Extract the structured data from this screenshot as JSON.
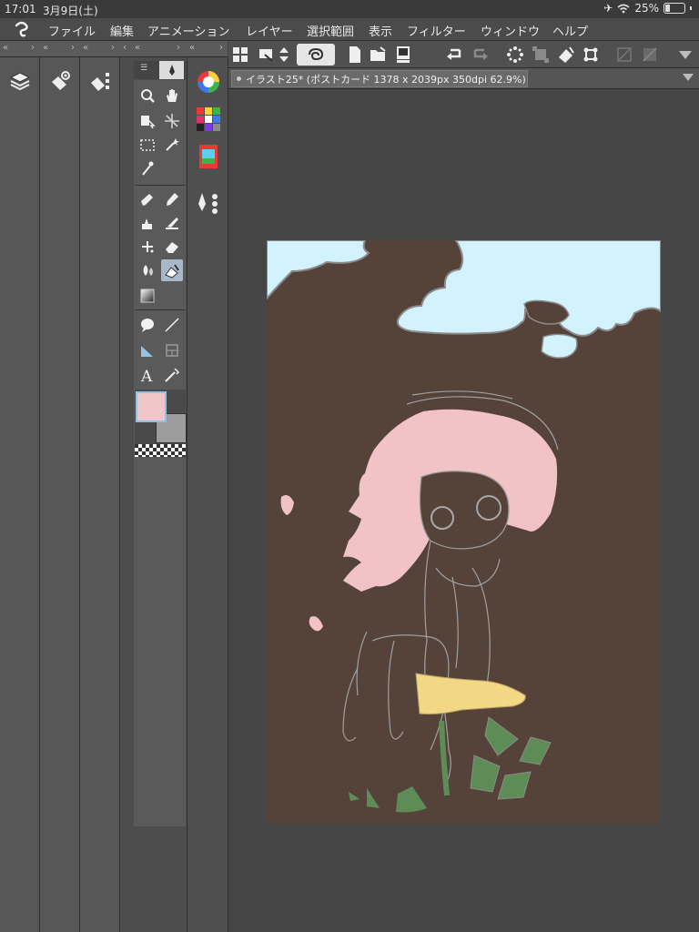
{
  "status_bar": {
    "time": "17:01",
    "date": "3月9日(土)",
    "battery": "25%"
  },
  "menu": {
    "items": [
      "ファイル",
      "編集",
      "アニメーション",
      "レイヤー",
      "選択範囲",
      "表示",
      "フィルター",
      "ウィンドウ",
      "ヘルプ"
    ]
  },
  "document_tab": {
    "title": "イラスト25* (ポストカード 1378 x 2039px 350dpi 62.9%)"
  },
  "colors": {
    "main_color": "#f0c6c9",
    "sub_color": "#9c9c9c",
    "canvas_background": "#55433a",
    "sky": "#d2f3fd",
    "hair": "#f2c3c6",
    "leaf": "#5e8c56",
    "highlight_tool": "#a7b8c9"
  },
  "icons": {
    "left_columns": [
      "layers-icon",
      "layer-property-icon",
      "layer-search-icon"
    ],
    "tools": [
      "zoom-icon",
      "hand-icon",
      "operation-icon",
      "move-layer-icon",
      "selection-icon",
      "auto-select-icon",
      "eyedropper-icon",
      "pen-icon",
      "pencil-icon",
      "brush-icon",
      "airbrush-icon",
      "decoration-icon",
      "eraser-icon",
      "blend-icon",
      "fill-icon",
      "gradient-icon",
      "balloon-icon",
      "line-icon",
      "ruler-icon",
      "frame-icon",
      "text-icon",
      "correct-line-icon"
    ],
    "subtools": [
      "color-wheel-icon",
      "color-set-icon",
      "animation-cels-icon",
      "sub-tool-detail-icon"
    ],
    "toolbar": [
      "grid-view-icon",
      "quick-access-icon",
      "scroll-arrows-icon",
      "companion-mode-icon",
      "new-file-icon",
      "open-file-icon",
      "save-icon",
      "undo-icon",
      "redo-icon",
      "sparkle-icon",
      "transform-icon",
      "fill-bucket-icon",
      "crop-icon",
      "clear-icon",
      "dropdown-icon"
    ]
  }
}
